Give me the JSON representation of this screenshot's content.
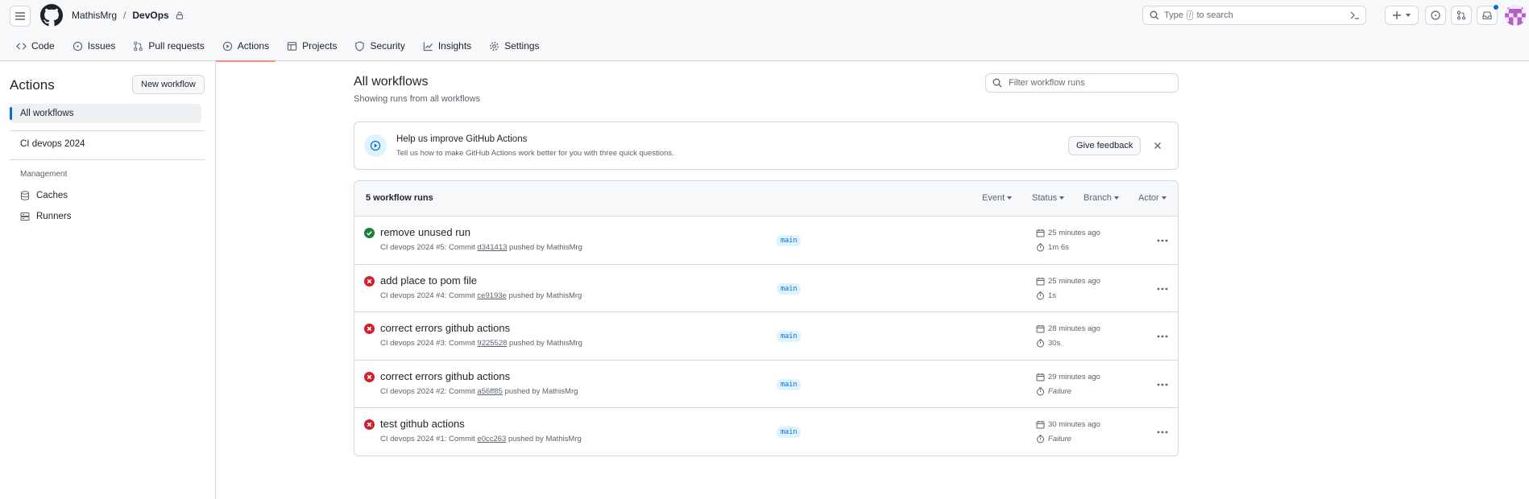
{
  "header": {
    "owner": "MathisMrg",
    "separator": "/",
    "repo": "DevOps",
    "search_prefix": "Type",
    "search_key": "/",
    "search_suffix": "to search"
  },
  "tabs": [
    {
      "label": "Code",
      "icon": "code-icon"
    },
    {
      "label": "Issues",
      "icon": "issue-opened-icon"
    },
    {
      "label": "Pull requests",
      "icon": "git-pull-request-icon"
    },
    {
      "label": "Actions",
      "icon": "play-icon",
      "active": true
    },
    {
      "label": "Projects",
      "icon": "table-icon"
    },
    {
      "label": "Security",
      "icon": "shield-icon"
    },
    {
      "label": "Insights",
      "icon": "graph-icon"
    },
    {
      "label": "Settings",
      "icon": "gear-icon"
    }
  ],
  "sidebar": {
    "title": "Actions",
    "new_workflow": "New workflow",
    "all_workflows": "All workflows",
    "workflow": "CI devops 2024",
    "management_heading": "Management",
    "caches": "Caches",
    "runners": "Runners"
  },
  "main": {
    "title": "All workflows",
    "subtitle": "Showing runs from all workflows",
    "filter_placeholder": "Filter workflow runs"
  },
  "banner": {
    "title": "Help us improve GitHub Actions",
    "subtitle": "Tell us how to make GitHub Actions work better for you with three quick questions.",
    "button": "Give feedback"
  },
  "runs": {
    "count": "5 workflow runs",
    "filters": [
      "Event",
      "Status",
      "Branch",
      "Actor"
    ],
    "items": [
      {
        "status": "success",
        "title": "remove unused run",
        "meta_prefix": "CI devops 2024 #5: Commit",
        "sha": "d341413",
        "meta_suffix": "pushed by MathisMrg",
        "branch": "main",
        "time": "25 minutes ago",
        "duration": "1m 6s"
      },
      {
        "status": "failure",
        "title": "add place to pom file",
        "meta_prefix": "CI devops 2024 #4: Commit",
        "sha": "ce9193e",
        "meta_suffix": "pushed by MathisMrg",
        "branch": "main",
        "time": "25 minutes ago",
        "duration": "1s"
      },
      {
        "status": "failure",
        "title": "correct errors github actions",
        "meta_prefix": "CI devops 2024 #3: Commit",
        "sha": "9225528",
        "meta_suffix": "pushed by MathisMrg",
        "branch": "main",
        "time": "28 minutes ago",
        "duration": "30s"
      },
      {
        "status": "failure",
        "title": "correct errors github actions",
        "meta_prefix": "CI devops 2024 #2: Commit",
        "sha": "a56ff85",
        "meta_suffix": "pushed by MathisMrg",
        "branch": "main",
        "time": "29 minutes ago",
        "duration": "Failure"
      },
      {
        "status": "failure",
        "title": "test github actions",
        "meta_prefix": "CI devops 2024 #1: Commit",
        "sha": "e0cc263",
        "meta_suffix": "pushed by MathisMrg",
        "branch": "main",
        "time": "30 minutes ago",
        "duration": "Failure"
      }
    ]
  },
  "colors": {
    "success": "#1a7f37",
    "failure": "#cf222e",
    "accent": "#0969da",
    "tab_underline": "#fd8c73"
  }
}
